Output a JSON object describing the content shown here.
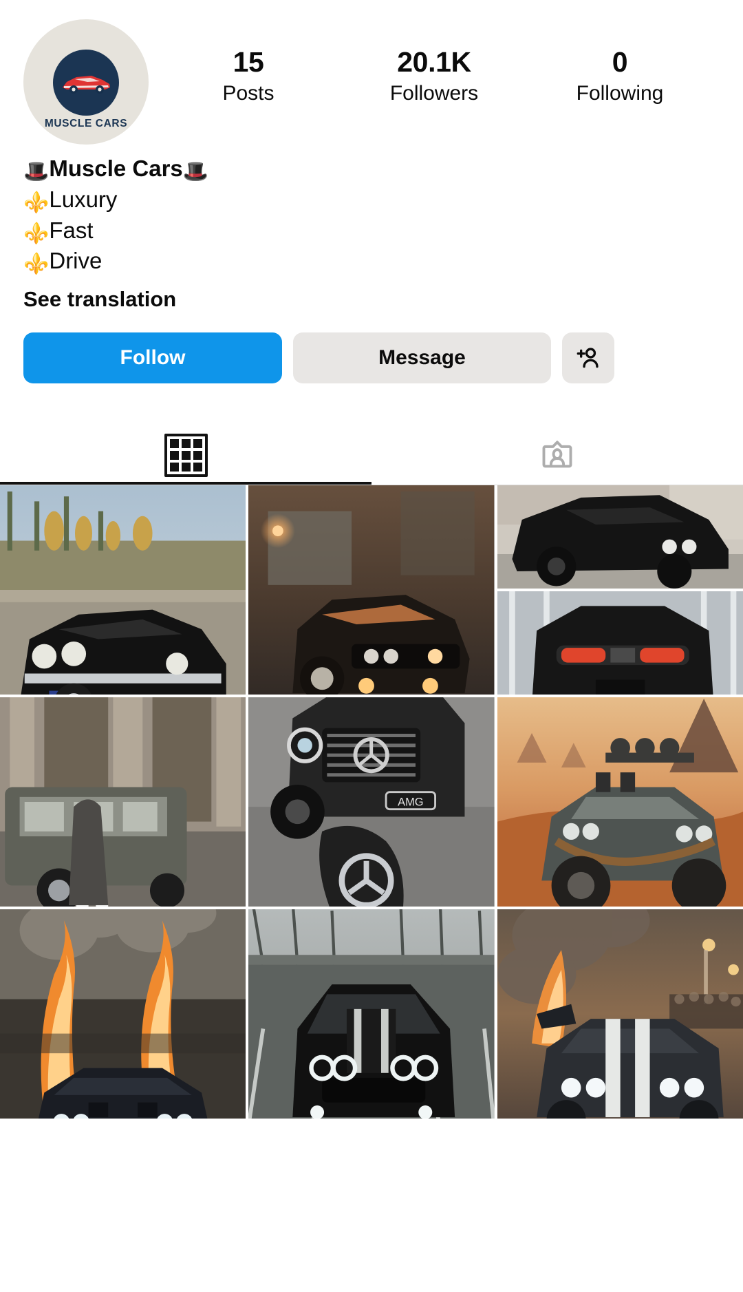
{
  "profile": {
    "avatar": {
      "icon_name": "muscle-cars-logo",
      "logo_text": "MUSCLE CARS"
    },
    "stats": [
      {
        "value": "15",
        "label": "Posts"
      },
      {
        "value": "20.1K",
        "label": "Followers"
      },
      {
        "value": "0",
        "label": "Following"
      }
    ],
    "bio": {
      "name_line": "Muscle Cars",
      "name_emoji_left": "🎩",
      "name_emoji_right": "🎩",
      "lines": [
        {
          "emoji": "⚜️",
          "text": "Luxury"
        },
        {
          "emoji": "⚜️",
          "text": "Fast"
        },
        {
          "emoji": "⚜️",
          "text": "Drive"
        }
      ],
      "see_translation": "See translation"
    },
    "actions": {
      "follow_label": "Follow",
      "message_label": "Message",
      "add_user_icon": "add-person-icon"
    },
    "tabs": [
      {
        "id": "grid",
        "icon": "grid-icon",
        "active": true
      },
      {
        "id": "tagged",
        "icon": "tagged-icon",
        "active": false
      }
    ]
  },
  "colors": {
    "follow_blue": "#0f95ea",
    "button_gray": "#e8e6e4",
    "text_dark": "#0b0b0b",
    "tab_active": "#121212",
    "tab_inactive": "#adadad"
  },
  "posts": [
    {
      "position": "r1c1",
      "alt": "black-classic-challenger-on-rural-road",
      "theme": "rural-daylight"
    },
    {
      "position": "r1c2",
      "alt": "orange-lit-dodge-charger-on-wet-street-at-dusk",
      "theme": "street-dusk"
    },
    {
      "position": "r1c3-top",
      "alt": "matte-black-modern-challenger-front-quarter",
      "theme": "city-day"
    },
    {
      "position": "r1c3-bottom",
      "alt": "black-challenger-rear-taillights",
      "theme": "garage-gate"
    },
    {
      "position": "r2c1",
      "alt": "person-in-long-coat-beside-grey-g-wagon",
      "theme": "stone-building"
    },
    {
      "position": "r2c2",
      "alt": "mercedes-amg-g-class-front-with-key-fob",
      "theme": "asphalt-day"
    },
    {
      "position": "r2c3",
      "alt": "post-apocalyptic-muscle-car-in-desert",
      "theme": "desert-sunset"
    },
    {
      "position": "r3c1",
      "alt": "challenger-with-twin-flame-burnout",
      "theme": "night-fire"
    },
    {
      "position": "r3c2",
      "alt": "black-challenger-in-empty-foggy-parking-lot",
      "theme": "fog-parking"
    },
    {
      "position": "r3c3",
      "alt": "widebody-challenger-burnout-before-crowd",
      "theme": "night-smoke"
    }
  ]
}
